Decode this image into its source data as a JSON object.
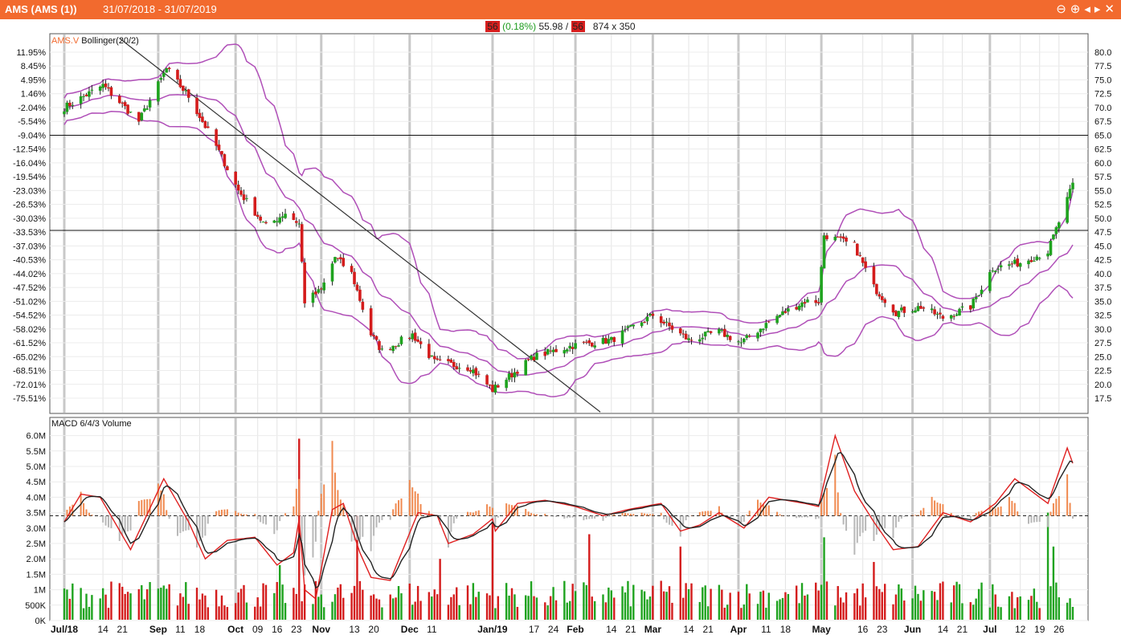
{
  "window": {
    "title": "AMS (AMS (1))",
    "date_range": "31/07/2018 - 31/07/2019",
    "controls": [
      "⊖",
      "⊕",
      "◂",
      "▸",
      "✕"
    ]
  },
  "info_bar": {
    "last_value": "56",
    "change": "(0.18%)",
    "price": "55.98",
    "separator": "/",
    "value2": "56",
    "size": "874 x 350"
  },
  "colors": {
    "up": "#1fa31f",
    "down": "#d41c1c",
    "band": "#b04fb8",
    "macd_fast": "#e02020",
    "macd_slow": "#222222",
    "hist_pos": "#f08a50",
    "hist_neg": "#b8b8b8"
  },
  "chart_data": [
    {
      "type": "candlestick",
      "legend": [
        "AMS.V",
        "Bollinger(20/2)"
      ],
      "y_right_ticks": [
        "80.0",
        "77.5",
        "75.0",
        "72.5",
        "70.0",
        "67.5",
        "65.0",
        "62.5",
        "60.0",
        "57.5",
        "55.0",
        "52.5",
        "50.0",
        "47.5",
        "45.0",
        "42.5",
        "40.0",
        "37.5",
        "35.0",
        "32.5",
        "30.0",
        "27.5",
        "25.0",
        "22.5",
        "20.0",
        "17.5"
      ],
      "y_left_ticks": [
        "11.95%",
        "8.45%",
        "4.95%",
        "1.46%",
        "-2.04%",
        "-5.54%",
        "-9.04%",
        "-12.54%",
        "-16.04%",
        "-19.54%",
        "-23.03%",
        "-26.53%",
        "-30.03%",
        "-33.53%",
        "-37.03%",
        "-40.53%",
        "-44.02%",
        "-47.52%",
        "-51.02%",
        "-54.52%",
        "-58.02%",
        "-61.52%",
        "-65.02%",
        "-68.51%",
        "-72.01%",
        "-75.51%"
      ],
      "ylim": [
        15,
        82
      ],
      "horizontal_lines": [
        65.0,
        47.8
      ],
      "trendline": {
        "from": [
          "2018-08-20",
          82.5
        ],
        "to": [
          "2019-02-10",
          15.0
        ]
      },
      "anchors": [
        [
          "2018-07-31",
          70.0
        ],
        [
          "2018-08-14",
          74.0
        ],
        [
          "2018-08-27",
          67.5
        ],
        [
          "2018-09-06",
          77.0
        ],
        [
          "2018-09-14",
          72.0
        ],
        [
          "2018-09-24",
          63.0
        ],
        [
          "2018-10-02",
          55.0
        ],
        [
          "2018-10-12",
          48.5
        ],
        [
          "2018-10-19",
          51.0
        ],
        [
          "2018-10-24",
          49.0
        ],
        [
          "2018-10-26",
          35.0
        ],
        [
          "2018-11-01",
          37.0
        ],
        [
          "2018-11-06",
          43.0
        ],
        [
          "2018-11-12",
          40.0
        ],
        [
          "2018-11-19",
          29.0
        ],
        [
          "2018-11-23",
          26.0
        ],
        [
          "2018-12-04",
          29.0
        ],
        [
          "2018-12-12",
          24.0
        ],
        [
          "2018-12-25",
          23.0
        ],
        [
          "2019-01-02",
          19.0
        ],
        [
          "2019-01-17",
          25.0
        ],
        [
          "2019-01-31",
          27.0
        ],
        [
          "2019-02-14",
          28.0
        ],
        [
          "2019-03-01",
          32.5
        ],
        [
          "2019-03-14",
          28.0
        ],
        [
          "2019-03-25",
          29.5
        ],
        [
          "2019-04-02",
          27.5
        ],
        [
          "2019-04-14",
          32.0
        ],
        [
          "2019-04-25",
          35.0
        ],
        [
          "2019-04-30",
          35.0
        ],
        [
          "2019-05-02",
          47.0
        ],
        [
          "2019-05-13",
          45.0
        ],
        [
          "2019-05-20",
          37.5
        ],
        [
          "2019-05-28",
          33.0
        ],
        [
          "2019-06-06",
          34.0
        ],
        [
          "2019-06-14",
          32.0
        ],
        [
          "2019-06-24",
          34.0
        ],
        [
          "2019-07-02",
          41.0
        ],
        [
          "2019-07-12",
          42.0
        ],
        [
          "2019-07-22",
          44.0
        ],
        [
          "2019-07-31",
          56.0
        ]
      ]
    },
    {
      "type": "macd_volume",
      "legend": "MACD 6/4/3 Volume",
      "y_left_ticks": [
        "6.0M",
        "5.5M",
        "5.0M",
        "4.5M",
        "4.0M",
        "3.5M",
        "3.0M",
        "2.5M",
        "2.0M",
        "1.5M",
        "1M",
        "500K",
        "0K"
      ],
      "ylim": [
        0,
        6200000
      ],
      "zero_line": 3400000,
      "macd_anchors": [
        [
          "2018-07-31",
          3.2
        ],
        [
          "2018-08-06",
          4.1
        ],
        [
          "2018-08-13",
          4.0
        ],
        [
          "2018-08-24",
          2.3
        ],
        [
          "2018-09-05",
          4.6
        ],
        [
          "2018-09-14",
          3.2
        ],
        [
          "2018-09-20",
          2.0
        ],
        [
          "2018-09-28",
          2.6
        ],
        [
          "2018-10-08",
          2.7
        ],
        [
          "2018-10-16",
          1.8
        ],
        [
          "2018-10-22",
          2.2
        ],
        [
          "2018-10-24",
          3.3
        ],
        [
          "2018-10-26",
          1.0
        ],
        [
          "2018-10-30",
          0.7
        ],
        [
          "2018-11-05",
          3.6
        ],
        [
          "2018-11-09",
          3.8
        ],
        [
          "2018-11-15",
          2.2
        ],
        [
          "2018-11-19",
          1.4
        ],
        [
          "2018-11-26",
          1.3
        ],
        [
          "2018-12-06",
          3.5
        ],
        [
          "2018-12-13",
          3.4
        ],
        [
          "2018-12-17",
          2.5
        ],
        [
          "2018-12-26",
          2.8
        ],
        [
          "2019-01-02",
          3.3
        ],
        [
          "2019-01-03",
          2.9
        ],
        [
          "2019-01-11",
          3.8
        ],
        [
          "2019-01-21",
          3.9
        ],
        [
          "2019-02-01",
          3.7
        ],
        [
          "2019-02-11",
          3.4
        ],
        [
          "2019-02-20",
          3.6
        ],
        [
          "2019-03-04",
          3.8
        ],
        [
          "2019-03-11",
          2.9
        ],
        [
          "2019-03-18",
          3.1
        ],
        [
          "2019-03-25",
          3.5
        ],
        [
          "2019-04-03",
          3.0
        ],
        [
          "2019-04-12",
          4.0
        ],
        [
          "2019-04-25",
          3.8
        ],
        [
          "2019-04-30",
          3.7
        ],
        [
          "2019-05-06",
          6.0
        ],
        [
          "2019-05-13",
          4.2
        ],
        [
          "2019-05-20",
          3.2
        ],
        [
          "2019-05-27",
          2.3
        ],
        [
          "2019-06-05",
          2.4
        ],
        [
          "2019-06-14",
          3.5
        ],
        [
          "2019-06-24",
          3.2
        ],
        [
          "2019-07-03",
          3.8
        ],
        [
          "2019-07-10",
          4.6
        ],
        [
          "2019-07-22",
          3.8
        ],
        [
          "2019-07-29",
          5.6
        ],
        [
          "2019-07-31",
          5.1
        ]
      ],
      "volume_spikes": [
        [
          "2018-10-24",
          5.9
        ],
        [
          "2018-10-17",
          1.8
        ],
        [
          "2018-11-14",
          3.4
        ],
        [
          "2018-12-14",
          2.0
        ],
        [
          "2019-01-02",
          3.2
        ],
        [
          "2019-02-06",
          2.8
        ],
        [
          "2019-03-11",
          2.4
        ],
        [
          "2019-05-02",
          2.7
        ],
        [
          "2019-05-20",
          1.9
        ],
        [
          "2019-07-22",
          3.5
        ],
        [
          "2019-07-24",
          2.4
        ]
      ]
    }
  ],
  "x_axis": {
    "labels": [
      [
        "2018-07-31",
        "Jul/18",
        true
      ],
      [
        "2018-08-14",
        "14",
        false
      ],
      [
        "2018-08-21",
        "21",
        false
      ],
      [
        "2018-09-03",
        "Sep",
        true
      ],
      [
        "2018-09-11",
        "11",
        false
      ],
      [
        "2018-09-18",
        "18",
        false
      ],
      [
        "2018-10-01",
        "Oct",
        true
      ],
      [
        "2018-10-09",
        "09",
        false
      ],
      [
        "2018-10-16",
        "16",
        false
      ],
      [
        "2018-10-23",
        "23",
        false
      ],
      [
        "2018-11-01",
        "Nov",
        true
      ],
      [
        "2018-11-13",
        "13",
        false
      ],
      [
        "2018-11-20",
        "20",
        false
      ],
      [
        "2018-12-03",
        "Dec",
        true
      ],
      [
        "2018-12-11",
        "11",
        false
      ],
      [
        "2019-01-02",
        "Jan/19",
        true
      ],
      [
        "2019-01-17",
        "17",
        false
      ],
      [
        "2019-01-24",
        "24",
        false
      ],
      [
        "2019-02-01",
        "Feb",
        true
      ],
      [
        "2019-02-14",
        "14",
        false
      ],
      [
        "2019-02-21",
        "21",
        false
      ],
      [
        "2019-03-01",
        "Mar",
        true
      ],
      [
        "2019-03-14",
        "14",
        false
      ],
      [
        "2019-03-21",
        "21",
        false
      ],
      [
        "2019-04-01",
        "Apr",
        true
      ],
      [
        "2019-04-11",
        "11",
        false
      ],
      [
        "2019-04-18",
        "18",
        false
      ],
      [
        "2019-05-01",
        "May",
        true
      ],
      [
        "2019-05-16",
        "16",
        false
      ],
      [
        "2019-05-23",
        "23",
        false
      ],
      [
        "2019-06-03",
        "Jun",
        true
      ],
      [
        "2019-06-14",
        "14",
        false
      ],
      [
        "2019-06-21",
        "21",
        false
      ],
      [
        "2019-07-01",
        "Jul",
        true
      ],
      [
        "2019-07-12",
        "12",
        false
      ],
      [
        "2019-07-19",
        "19",
        false
      ],
      [
        "2019-07-26",
        "26",
        false
      ]
    ]
  }
}
